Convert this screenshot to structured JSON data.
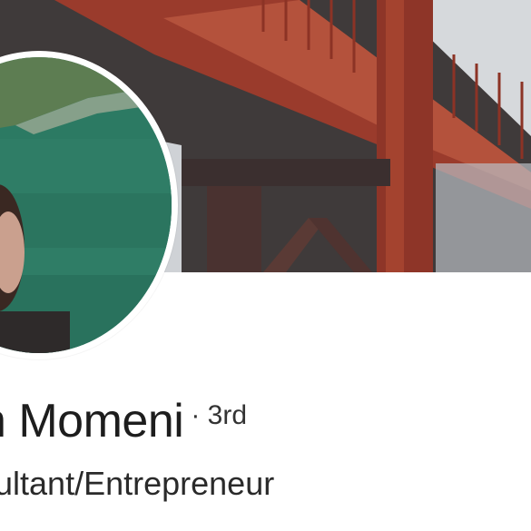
{
  "profile": {
    "name": "n Momeni",
    "degree": "· 3rd",
    "headline": "ultant/Entrepreneur"
  },
  "images": {
    "cover": "golden-gate-bridge-photo",
    "avatar": "profile-photo-lake-selfie"
  },
  "colors": {
    "bridge": "#a5412f",
    "water": "#2f7a62",
    "text": "#1d1d1d"
  }
}
